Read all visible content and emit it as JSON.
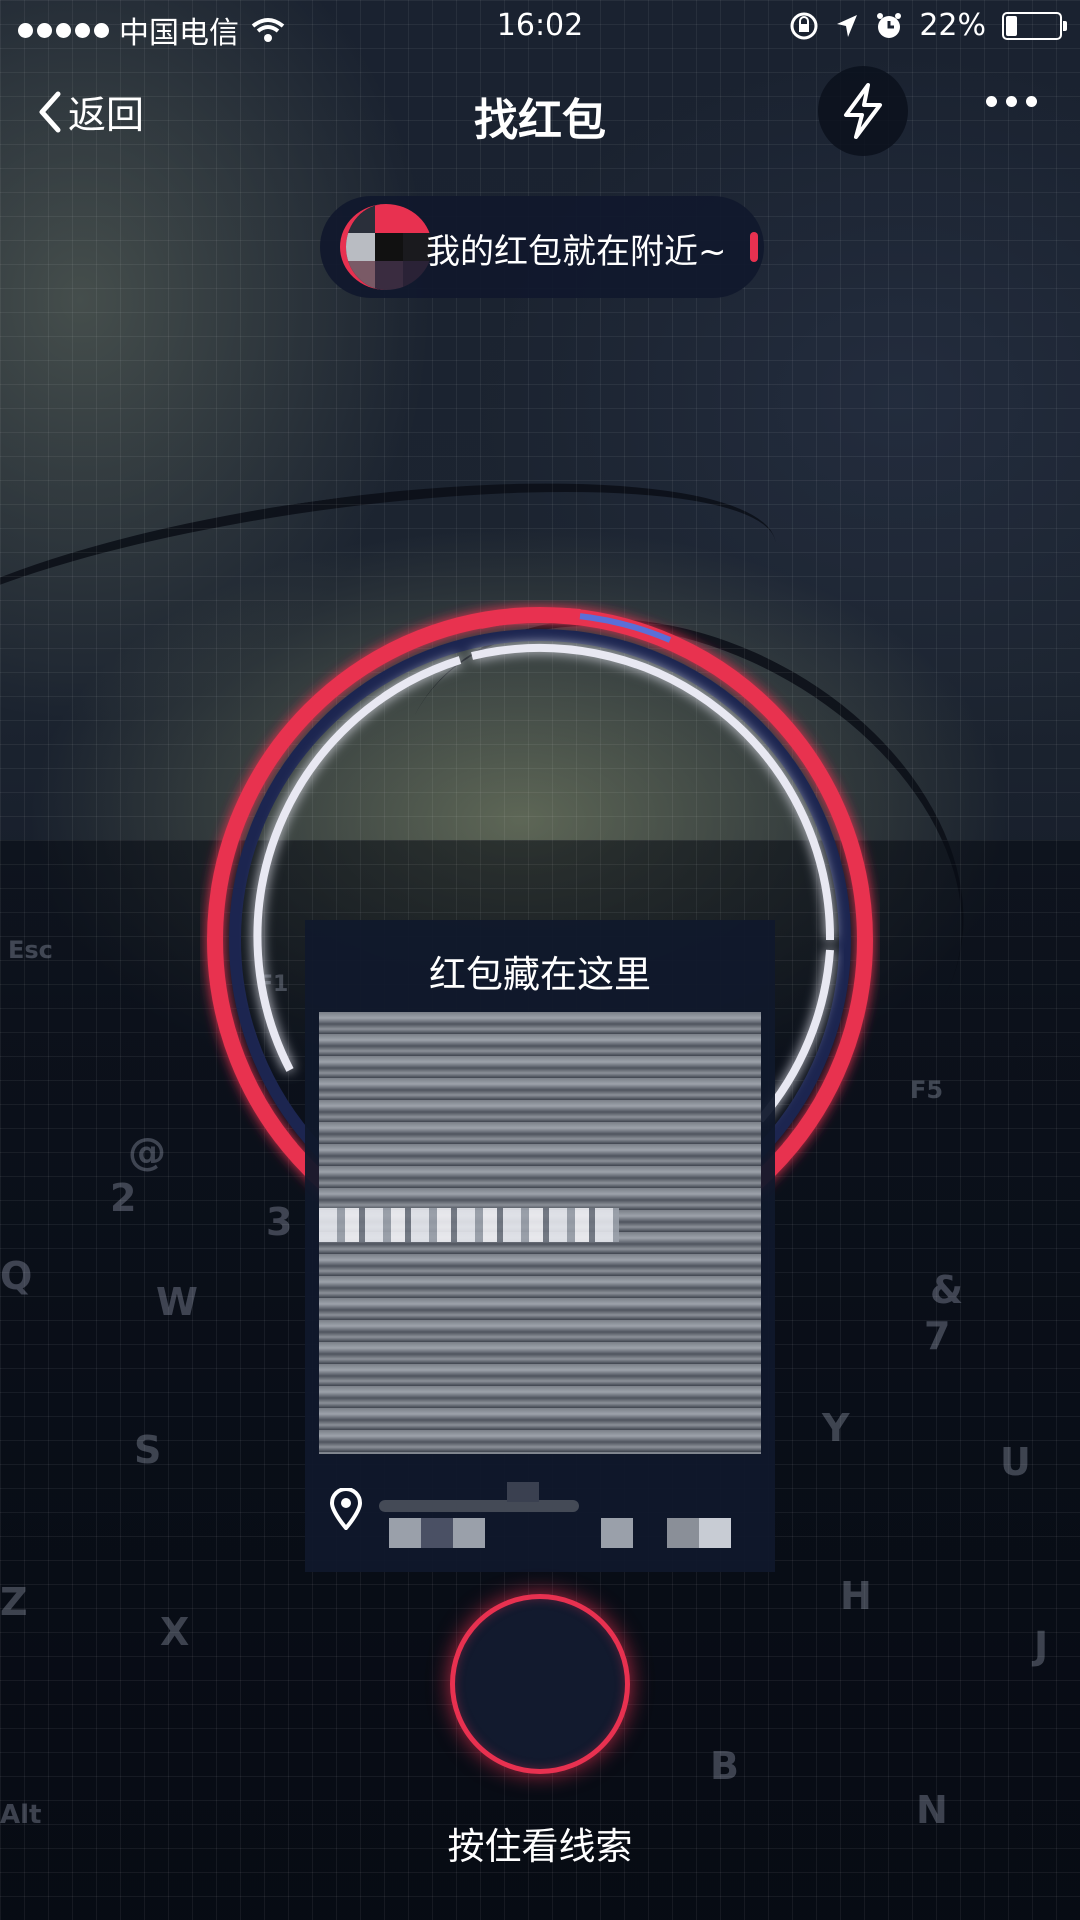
{
  "status_bar": {
    "carrier": "中国电信",
    "time": "16:02",
    "battery": "22%",
    "battery_level": 0.22
  },
  "nav": {
    "back_label": "返回",
    "title": "找红包",
    "flash_icon": "lightning-icon",
    "more_icon": "more-dots-icon"
  },
  "hint": {
    "text": "我的红包就在附近~"
  },
  "clue_card": {
    "title": "红包藏在这里"
  },
  "hold": {
    "label": "按住看线索"
  },
  "colors": {
    "accent_red": "#e83150",
    "panel_dark": "#101a2c",
    "ring_white": "#e8e8f2",
    "ring_blue": "#5a6fd8"
  },
  "keyboard_keys": [
    "Esc",
    "F1",
    "@",
    "2",
    "3",
    "Q",
    "W",
    "S",
    "Z",
    "X",
    "F5",
    "&",
    "7",
    "Y",
    "U",
    "H",
    "J",
    "B",
    "N",
    "Alt"
  ]
}
